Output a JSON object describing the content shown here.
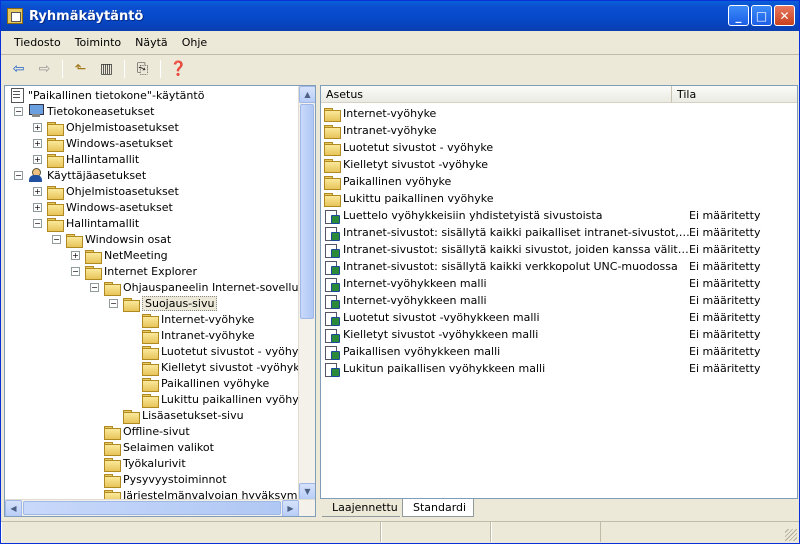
{
  "window": {
    "title": "Ryhmäkäytäntö"
  },
  "menu": [
    "Tiedosto",
    "Toiminto",
    "Näytä",
    "Ohje"
  ],
  "tree": [
    {
      "label": "\"Paikallinen tietokone\"-käytäntö",
      "level": 0,
      "icon": "policy-doc-icon",
      "expander": "none"
    },
    {
      "label": "Tietokoneasetukset",
      "level": 1,
      "icon": "computer-icon",
      "expander": "minus"
    },
    {
      "label": "Ohjelmistoasetukset",
      "level": 2,
      "icon": "folder-icon",
      "expander": "plus"
    },
    {
      "label": "Windows-asetukset",
      "level": 2,
      "icon": "folder-icon",
      "expander": "plus"
    },
    {
      "label": "Hallintamallit",
      "level": 2,
      "icon": "folder-icon",
      "expander": "plus"
    },
    {
      "label": "Käyttäjäasetukset",
      "level": 1,
      "icon": "user-icon",
      "expander": "minus"
    },
    {
      "label": "Ohjelmistoasetukset",
      "level": 2,
      "icon": "folder-icon",
      "expander": "plus"
    },
    {
      "label": "Windows-asetukset",
      "level": 2,
      "icon": "folder-icon",
      "expander": "plus"
    },
    {
      "label": "Hallintamallit",
      "level": 2,
      "icon": "folder-icon",
      "expander": "minus"
    },
    {
      "label": "Windowsin osat",
      "level": 3,
      "icon": "folder-icon",
      "expander": "minus"
    },
    {
      "label": "NetMeeting",
      "level": 4,
      "icon": "folder-icon",
      "expander": "plus"
    },
    {
      "label": "Internet Explorer",
      "level": 4,
      "icon": "folder-icon",
      "expander": "minus"
    },
    {
      "label": "Ohjauspaneelin Internet-sovellus",
      "level": 5,
      "icon": "folder-icon",
      "expander": "minus"
    },
    {
      "label": "Suojaus-sivu",
      "level": 6,
      "icon": "folder-open-icon",
      "expander": "minus",
      "selected": true
    },
    {
      "label": "Internet-vyöhyke",
      "level": 7,
      "icon": "folder-icon",
      "expander": "none"
    },
    {
      "label": "Intranet-vyöhyke",
      "level": 7,
      "icon": "folder-icon",
      "expander": "none"
    },
    {
      "label": "Luotetut sivustot - vyöhyke",
      "level": 7,
      "icon": "folder-icon",
      "expander": "none"
    },
    {
      "label": "Kielletyt sivustot -vyöhyke",
      "level": 7,
      "icon": "folder-icon",
      "expander": "none"
    },
    {
      "label": "Paikallinen vyöhyke",
      "level": 7,
      "icon": "folder-icon",
      "expander": "none"
    },
    {
      "label": "Lukittu paikallinen vyöhyke",
      "level": 7,
      "icon": "folder-icon",
      "expander": "none"
    },
    {
      "label": "Lisäasetukset-sivu",
      "level": 6,
      "icon": "folder-icon",
      "expander": "none"
    },
    {
      "label": "Offline-sivut",
      "level": 5,
      "icon": "folder-icon",
      "expander": "none"
    },
    {
      "label": "Selaimen valikot",
      "level": 5,
      "icon": "folder-icon",
      "expander": "none"
    },
    {
      "label": "Työkalurivit",
      "level": 5,
      "icon": "folder-icon",
      "expander": "none"
    },
    {
      "label": "Pysyvyystoiminnot",
      "level": 5,
      "icon": "folder-icon",
      "expander": "none"
    },
    {
      "label": "Järjestelmänvalvojan hyväksymät ko",
      "level": 5,
      "icon": "folder-icon",
      "expander": "none"
    }
  ],
  "list": {
    "columns": [
      "Asetus",
      "Tila"
    ],
    "rows": [
      {
        "name": "Internet-vyöhyke",
        "state": "",
        "icon": "folder-icon"
      },
      {
        "name": "Intranet-vyöhyke",
        "state": "",
        "icon": "folder-icon"
      },
      {
        "name": "Luotetut sivustot - vyöhyke",
        "state": "",
        "icon": "folder-icon"
      },
      {
        "name": "Kielletyt sivustot -vyöhyke",
        "state": "",
        "icon": "folder-icon"
      },
      {
        "name": "Paikallinen vyöhyke",
        "state": "",
        "icon": "folder-icon"
      },
      {
        "name": "Lukittu paikallinen vyöhyke",
        "state": "",
        "icon": "folder-icon"
      },
      {
        "name": "Luettelo vyöhykkeisiin yhdistetyistä sivustoista",
        "state": "Ei määritetty",
        "icon": "policy-setting-icon"
      },
      {
        "name": "Intranet-sivustot: sisällytä kaikki paikalliset intranet-sivustot, joita...",
        "state": "Ei määritetty",
        "icon": "policy-setting-icon"
      },
      {
        "name": "Intranet-sivustot: sisällytä kaikki sivustot, joiden kanssa välityspal...",
        "state": "Ei määritetty",
        "icon": "policy-setting-icon"
      },
      {
        "name": "Intranet-sivustot: sisällytä kaikki verkkopolut UNC-muodossa",
        "state": "Ei määritetty",
        "icon": "policy-setting-icon"
      },
      {
        "name": "Internet-vyöhykkeen malli",
        "state": "Ei määritetty",
        "icon": "policy-setting-icon"
      },
      {
        "name": "Internet-vyöhykkeen malli",
        "state": "Ei määritetty",
        "icon": "policy-setting-icon"
      },
      {
        "name": "Luotetut sivustot -vyöhykkeen malli",
        "state": "Ei määritetty",
        "icon": "policy-setting-icon"
      },
      {
        "name": "Kielletyt sivustot -vyöhykkeen malli",
        "state": "Ei määritetty",
        "icon": "policy-setting-icon"
      },
      {
        "name": "Paikallisen vyöhykkeen malli",
        "state": "Ei määritetty",
        "icon": "policy-setting-icon"
      },
      {
        "name": "Lukitun paikallisen vyöhykkeen malli",
        "state": "Ei määritetty",
        "icon": "policy-setting-icon"
      }
    ]
  },
  "tabs": [
    {
      "label": "Laajennettu",
      "active": false
    },
    {
      "label": "Standardi",
      "active": true
    }
  ],
  "colors": {
    "titlebar": "#0a5fd8",
    "selection": "#ece9d8",
    "border": "#7f9db9"
  }
}
